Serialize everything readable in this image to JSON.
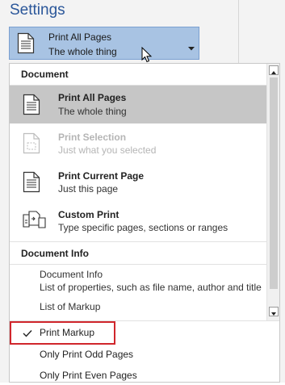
{
  "settings_heading": "Settings",
  "dropdown": {
    "title": "Print All Pages",
    "subtitle": "The whole thing"
  },
  "menu": {
    "section_document": "Document",
    "items": [
      {
        "label": "Print All Pages",
        "sub": "The whole thing",
        "icon": "page-icon"
      },
      {
        "label": "Print Selection",
        "sub": "Just what you selected",
        "icon": "selection-page-icon"
      },
      {
        "label": "Print Current Page",
        "sub": "Just this page",
        "icon": "page-icon"
      },
      {
        "label": "Custom Print",
        "sub": "Type specific pages, sections or ranges",
        "icon": "custom-print-icon"
      }
    ],
    "section_document_info": "Document Info",
    "info_items": [
      {
        "label": "Document Info",
        "sub": "List of properties, such as file name, author and title"
      },
      {
        "label": "List of Markup",
        "sub": ""
      }
    ],
    "bottom_items": [
      {
        "label": "Print Markup",
        "checked": true
      },
      {
        "label": "Only Print Odd Pages",
        "checked": false
      },
      {
        "label": "Only Print Even Pages",
        "checked": false
      }
    ]
  },
  "colors": {
    "accent": "#2b579a",
    "dropdown_bg": "#a8c3e3",
    "selected_bg": "#c6c6c6",
    "highlight": "#d0262c"
  }
}
